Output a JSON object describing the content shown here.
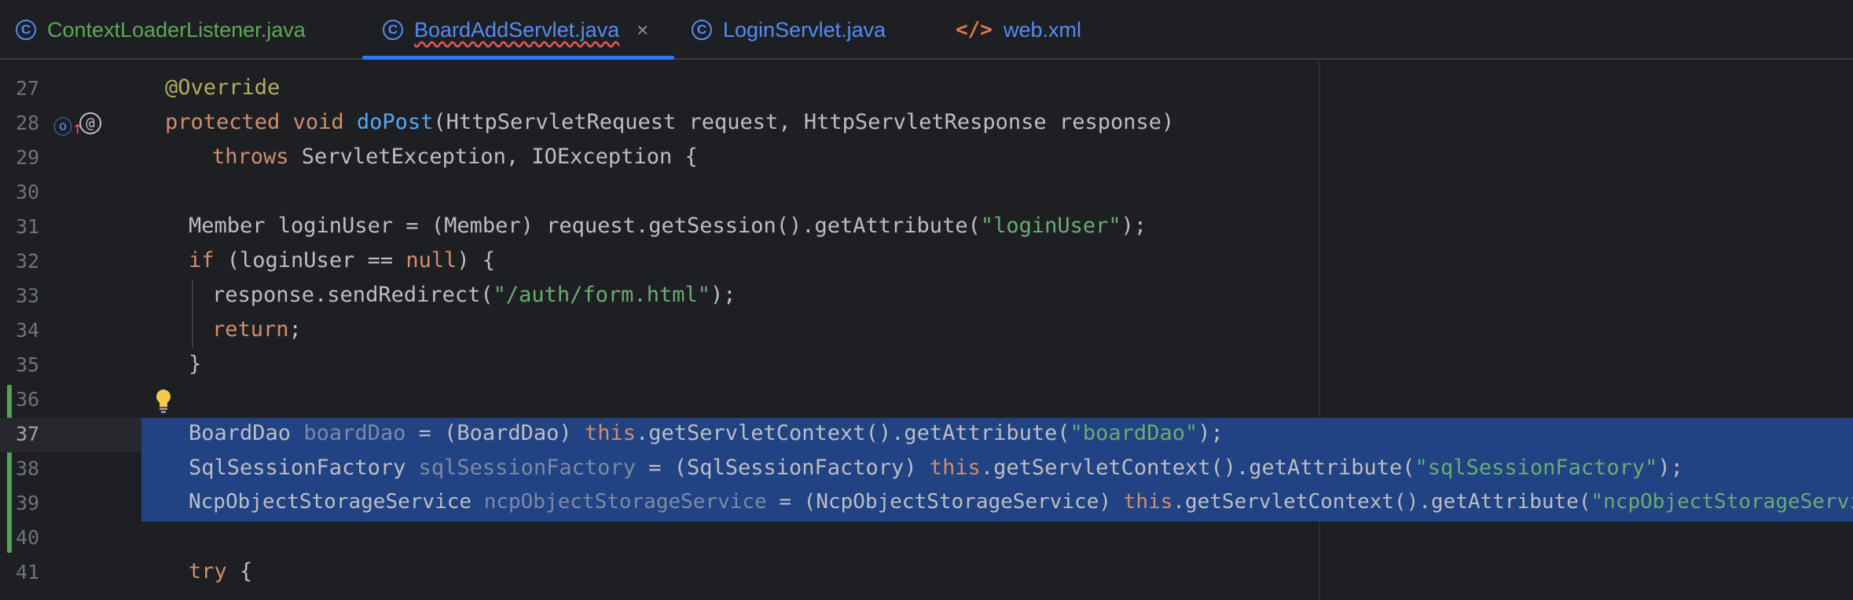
{
  "tabs": [
    {
      "label": "ContextLoaderListener.java",
      "icon": "class-icon"
    },
    {
      "label": "BoardAddServlet.java",
      "icon": "class-icon",
      "active": true
    },
    {
      "label": "LoginServlet.java",
      "icon": "class-icon"
    },
    {
      "label": "web.xml",
      "icon": "xml-icon"
    }
  ],
  "editor": {
    "lines": {
      "l27": {
        "num": "27",
        "annotation": "@Override"
      },
      "l28": {
        "num": "28",
        "kw1": "protected",
        "kw2": "void",
        "fn": "doPost",
        "rest": "(HttpServletRequest request, HttpServletResponse response)"
      },
      "l29": {
        "num": "29",
        "kw": "throws",
        "rest": " ServletException, IOException {"
      },
      "l30": {
        "num": "30"
      },
      "l31": {
        "num": "31",
        "pre": "Member loginUser = (Member) request.getSession().getAttribute(",
        "str": "\"loginUser\"",
        "post": ");"
      },
      "l32": {
        "num": "32",
        "kw": "if",
        "pre": " (loginUser == ",
        "kw2": "null",
        "post": ") {"
      },
      "l33": {
        "num": "33",
        "pre": "response.sendRedirect(",
        "str": "\"/auth/form.html\"",
        "post": ");"
      },
      "l34": {
        "num": "34",
        "kw": "return",
        "post": ";"
      },
      "l35": {
        "num": "35",
        "text": "}"
      },
      "l36": {
        "num": "36"
      },
      "l37": {
        "num": "37",
        "type": "BoardDao ",
        "var": "boardDao",
        "mid": " = (BoardDao) ",
        "kw": "this",
        "call": ".getServletContext().getAttribute(",
        "str": "\"boardDao\"",
        "post": ");"
      },
      "l38": {
        "num": "38",
        "type": "SqlSessionFactory ",
        "var": "sqlSessionFactory",
        "mid": " = (SqlSessionFactory) ",
        "kw": "this",
        "call": ".getServletContext().getAttribute(",
        "str": "\"sqlSessionFactory\"",
        "post": ");"
      },
      "l39": {
        "num": "39",
        "type": "NcpObjectStorageService ",
        "var": "ncpObjectStorageService",
        "mid": " = (NcpObjectStorageService) ",
        "kw": "this",
        "call": ".getServletContext().getAttribute(",
        "str": "\"ncpObjectStorageService\"",
        "post": ");"
      },
      "l40": {
        "num": "40"
      },
      "l41": {
        "num": "41",
        "kw": "try",
        "post": " {"
      }
    },
    "gutter_icons": {
      "override_icon": "ⓞ",
      "override_arrow": "↑",
      "annotation_icon": "@"
    }
  },
  "colors": {
    "selection": "#214283",
    "keyword": "#cf8e6d",
    "string": "#6aab73",
    "function": "#56a8f5",
    "annotation": "#b3ae60"
  }
}
